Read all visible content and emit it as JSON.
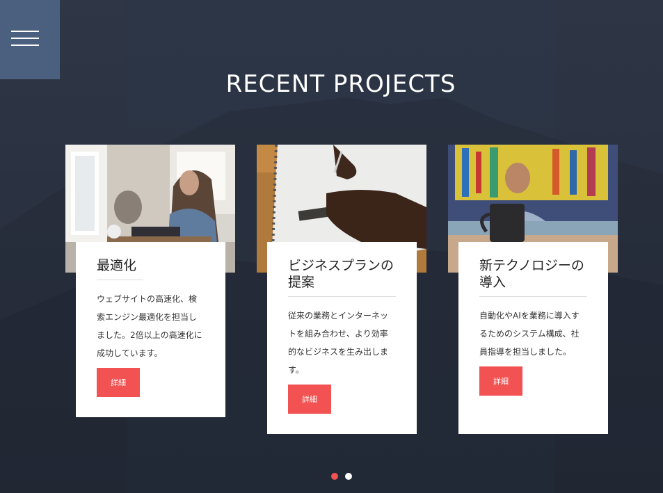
{
  "section": {
    "title": "RECENT PROJECTS"
  },
  "menu": {
    "icon": "hamburger-menu-icon"
  },
  "colors": {
    "accent": "#f25252",
    "menu_block": "#4a607e",
    "background": "#293140",
    "dot_active": "#f25252",
    "dot_inactive": "#ffffff"
  },
  "projects": [
    {
      "title": "最適化",
      "description": "ウェブサイトの高速化、検索エンジン最適化を担当しました。2倍以上の高速化に成功しています。",
      "button_label": "詳細",
      "image": "woman-working-on-laptop-photo"
    },
    {
      "title": "ビジネスプランの提案",
      "description": "従来の業務とインターネットを組み合わせ、より効率的なビジネスを生み出します。",
      "button_label": "詳細",
      "image": "hand-drawing-on-notebook-photo"
    },
    {
      "title": "新テクノロジーの導入",
      "description": "自動化やAIを業務に導入するためのシステム構成、社員指導を担当しました。",
      "button_label": "詳細",
      "image": "man-with-coffee-mug-photo"
    }
  ],
  "carousel": {
    "pages": 2,
    "active_page": 1
  }
}
